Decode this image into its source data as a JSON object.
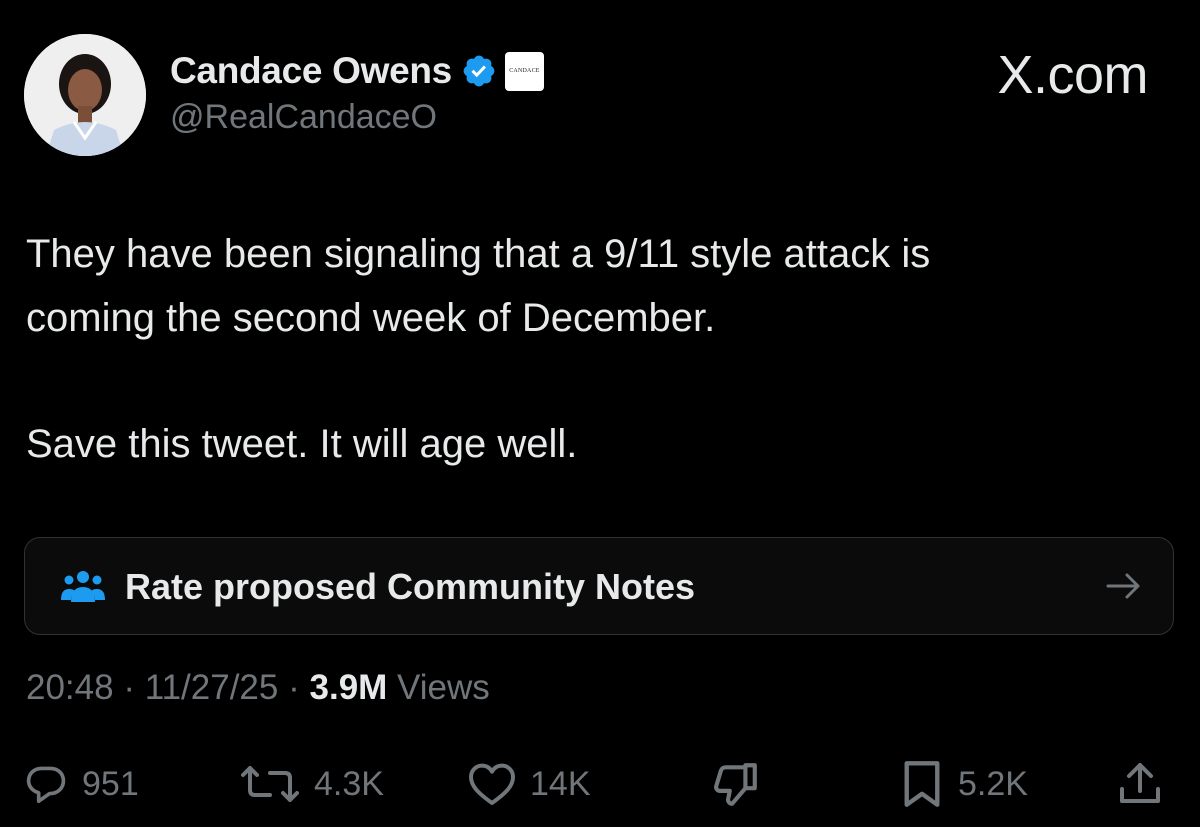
{
  "author": {
    "display_name": "Candace Owens",
    "handle": "@RealCandaceO",
    "affiliate_badge_text": "CANDACE",
    "verified_color": "#1d9bf0"
  },
  "watermark": "X.com",
  "tweet": {
    "lines": [
      "They have been signaling that a 9/11 style attack is",
      "coming the second week of December."
    ],
    "second_paragraph": "Save this tweet. It will age well."
  },
  "community_notes": {
    "label": "Rate proposed Community Notes",
    "icon": "people-icon",
    "icon_color": "#1d9bf0",
    "arrow_icon": "arrow-right-icon"
  },
  "meta": {
    "time": "20:48",
    "separator": "·",
    "date": "11/27/25",
    "views_count": "3.9M",
    "views_label": "Views"
  },
  "actions": {
    "replies": "951",
    "reposts": "4.3K",
    "likes": "14K",
    "bookmarks": "5.2K"
  },
  "colors": {
    "background": "#000000",
    "primary_text": "#e7e9ea",
    "secondary_text": "#71767b",
    "accent": "#1d9bf0"
  }
}
